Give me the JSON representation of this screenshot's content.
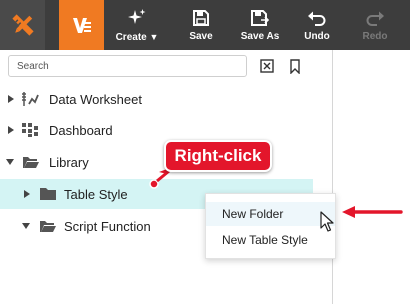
{
  "toolbar": {
    "buttons": [
      {
        "label": "Create",
        "icon": "sparkle-icon",
        "has_dropdown": true
      },
      {
        "label": "Save",
        "icon": "save-icon"
      },
      {
        "label": "Save As",
        "icon": "save-as-icon"
      },
      {
        "label": "Undo",
        "icon": "undo-icon"
      },
      {
        "label": "Redo",
        "icon": "redo-icon",
        "disabled": true
      }
    ]
  },
  "search": {
    "placeholder": "Search"
  },
  "tree": [
    {
      "label": "Data Worksheet",
      "icon": "worksheet-icon",
      "expanded": false
    },
    {
      "label": "Dashboard",
      "icon": "dashboard-icon",
      "expanded": false
    },
    {
      "label": "Library",
      "icon": "folder-open-icon",
      "expanded": true
    },
    {
      "label": "Table Style",
      "icon": "folder-icon",
      "expanded": false,
      "selected": true
    },
    {
      "label": "Script Function",
      "icon": "folder-open-icon",
      "expanded": true
    }
  ],
  "context_menu": {
    "items": [
      {
        "label": "New Folder",
        "hovered": true
      },
      {
        "label": "New Table Style"
      }
    ]
  },
  "annotation": {
    "callout_text": "Right-click"
  },
  "colors": {
    "toolbar_bg": "#3d3d3d",
    "app_tile": "#f07a22",
    "selected_row": "#d4f4f4",
    "annotation_red": "#e3162b"
  }
}
